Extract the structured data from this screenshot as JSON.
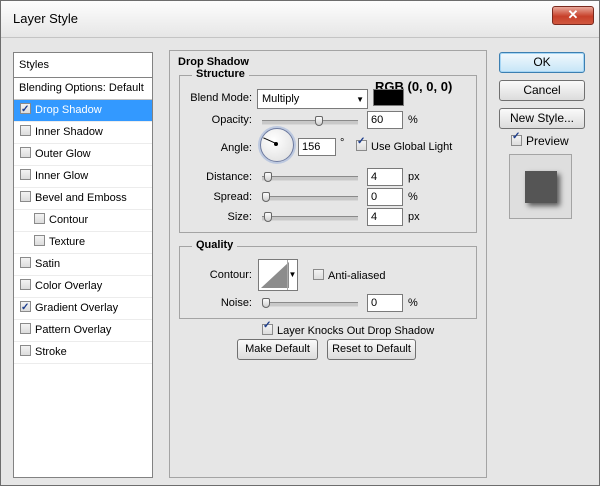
{
  "window": {
    "title": "Layer Style",
    "close_label": "✕"
  },
  "styles_list": {
    "header": "Styles",
    "blending_options": "Blending Options: Default",
    "items": [
      {
        "label": "Drop Shadow",
        "checked": true,
        "selected": true,
        "sub": false
      },
      {
        "label": "Inner Shadow",
        "checked": false,
        "selected": false,
        "sub": false
      },
      {
        "label": "Outer Glow",
        "checked": false,
        "selected": false,
        "sub": false
      },
      {
        "label": "Inner Glow",
        "checked": false,
        "selected": false,
        "sub": false
      },
      {
        "label": "Bevel and Emboss",
        "checked": false,
        "selected": false,
        "sub": false
      },
      {
        "label": "Contour",
        "checked": false,
        "selected": false,
        "sub": true
      },
      {
        "label": "Texture",
        "checked": false,
        "selected": false,
        "sub": true
      },
      {
        "label": "Satin",
        "checked": false,
        "selected": false,
        "sub": false
      },
      {
        "label": "Color Overlay",
        "checked": false,
        "selected": false,
        "sub": false
      },
      {
        "label": "Gradient Overlay",
        "checked": true,
        "selected": false,
        "sub": false
      },
      {
        "label": "Pattern Overlay",
        "checked": false,
        "selected": false,
        "sub": false
      },
      {
        "label": "Stroke",
        "checked": false,
        "selected": false,
        "sub": false
      }
    ]
  },
  "drop_shadow": {
    "title": "Drop Shadow",
    "structure": {
      "title": "Structure",
      "rgb_note": "RGB (0, 0, 0)",
      "blend_mode_label": "Blend Mode:",
      "blend_mode_value": "Multiply",
      "shadow_color": "#000000",
      "opacity_label": "Opacity:",
      "opacity_value": "60",
      "opacity_unit": "%",
      "opacity_level": 60,
      "angle_label": "Angle:",
      "angle_value": "156",
      "angle_unit": "°",
      "use_global_light_label": "Use Global Light",
      "use_global_light": true,
      "distance_label": "Distance:",
      "distance_value": "4",
      "distance_unit": "px",
      "distance_level": 2,
      "spread_label": "Spread:",
      "spread_value": "0",
      "spread_unit": "%",
      "spread_level": 0,
      "size_label": "Size:",
      "size_value": "4",
      "size_unit": "px",
      "size_level": 2
    },
    "quality": {
      "title": "Quality",
      "contour_label": "Contour:",
      "anti_aliased_label": "Anti-aliased",
      "anti_aliased": false,
      "noise_label": "Noise:",
      "noise_value": "0",
      "noise_unit": "%",
      "noise_level": 0
    },
    "knocks_out_label": "Layer Knocks Out Drop Shadow",
    "knocks_out": true,
    "make_default_label": "Make Default",
    "reset_default_label": "Reset to Default"
  },
  "buttons": {
    "ok": "OK",
    "cancel": "Cancel",
    "new_style": "New Style...",
    "preview_label": "Preview",
    "preview_checked": true
  },
  "icons": {
    "close": "close-icon",
    "dropdown": "chevron-down-icon",
    "checkbox": "checkmark-icon",
    "angle_dial": "angle-dial-icon",
    "contour": "contour-curve-icon"
  }
}
